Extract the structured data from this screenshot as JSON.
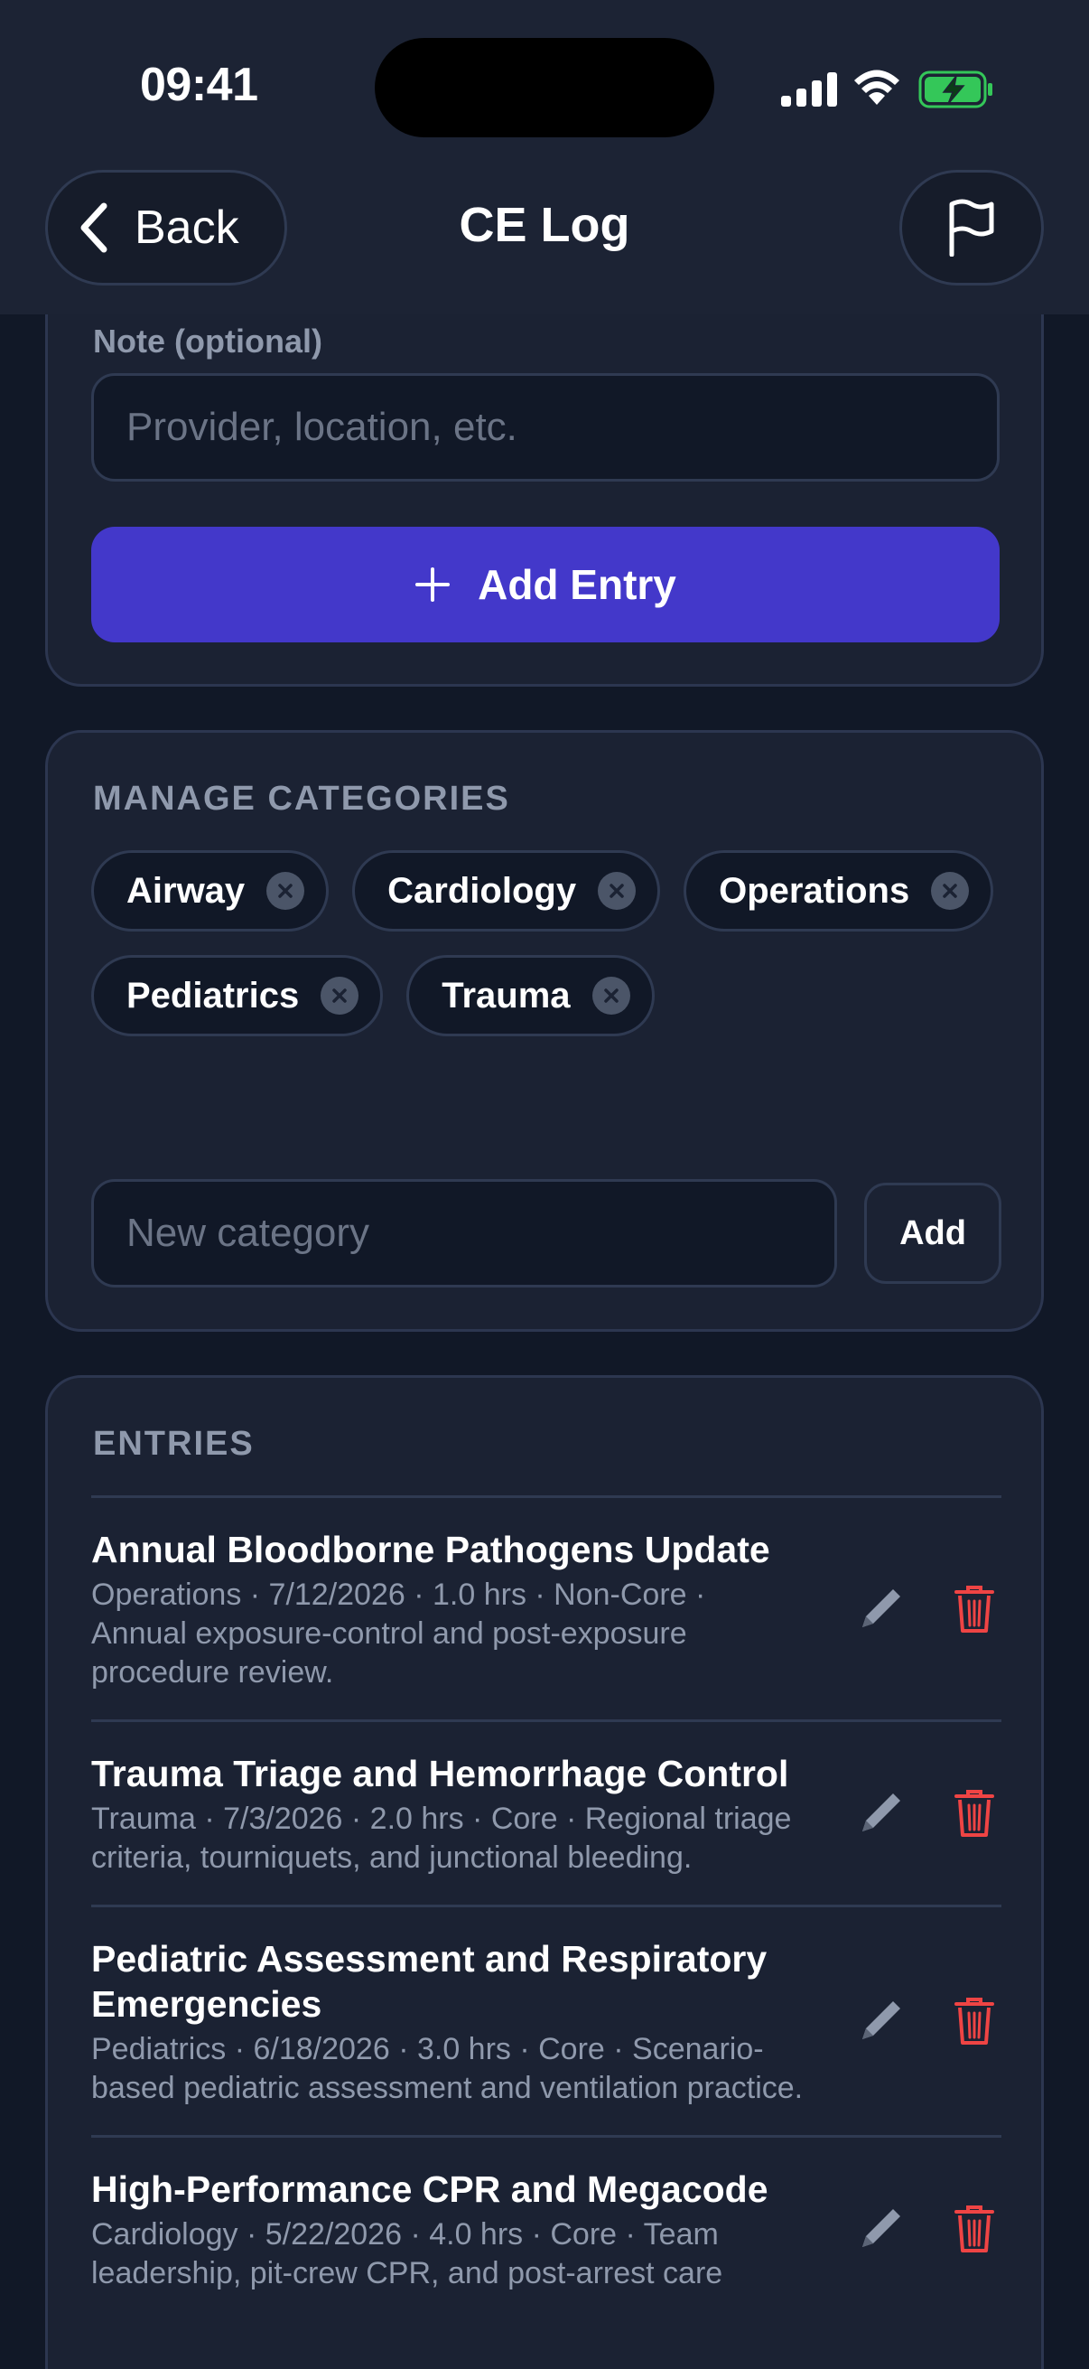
{
  "status_bar": {
    "time": "09:41"
  },
  "nav": {
    "back_label": "Back",
    "title": "CE Log",
    "flag_icon": "flag-icon"
  },
  "entry_form": {
    "note_label": "Note (optional)",
    "note_placeholder": "Provider, location, etc.",
    "note_value": "",
    "add_button_label": "Add Entry"
  },
  "categories": {
    "heading": "MANAGE CATEGORIES",
    "items": [
      "Airway",
      "Cardiology",
      "Operations",
      "Pediatrics",
      "Trauma"
    ],
    "new_placeholder": "New category",
    "add_label": "Add"
  },
  "entries": {
    "heading": "ENTRIES",
    "items": [
      {
        "title": "Annual Bloodborne Pathogens Update",
        "meta": "Operations · 7/12/2026 · 1.0 hrs · Non-Core · Annual exposure-control and post-exposure procedure review."
      },
      {
        "title": "Trauma Triage and Hemorrhage Control",
        "meta": "Trauma · 7/3/2026 · 2.0 hrs · Core · Regional triage criteria, tourniquets, and junctional bleeding."
      },
      {
        "title": "Pediatric Assessment and Respiratory Emergencies",
        "meta": "Pediatrics · 6/18/2026 · 3.0 hrs · Core · Scenario-based pediatric assessment and ventilation practice."
      },
      {
        "title": "High-Performance CPR and Megacode",
        "meta": "Cardiology · 5/22/2026 · 4.0 hrs · Core · Team leadership, pit-crew CPR, and post-arrest care"
      }
    ]
  },
  "colors": {
    "background": "#111827",
    "card": "#1b2233",
    "accent": "#4338ca",
    "delete": "#ef4444",
    "muted_text": "#8f99ac",
    "battery": "#34c759"
  }
}
